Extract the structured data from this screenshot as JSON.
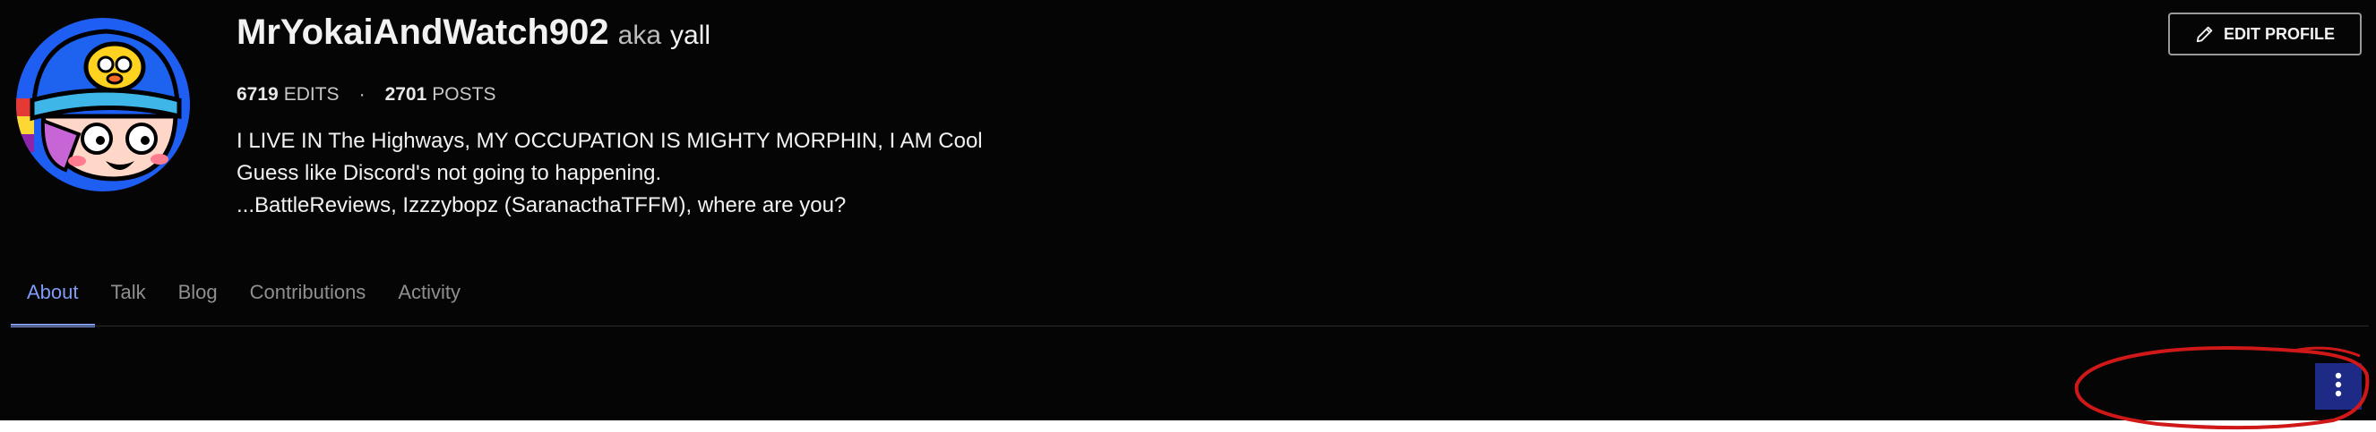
{
  "profile": {
    "username": "MrYokaiAndWatch902",
    "aka_label": "aka",
    "nickname": "yall",
    "stats": {
      "edits_count": "6719",
      "edits_label": "EDITS",
      "separator": "·",
      "posts_count": "2701",
      "posts_label": "POSTS"
    },
    "bio": [
      "I LIVE IN The Highways, MY OCCUPATION IS MIGHTY MORPHIN, I AM Cool",
      "Guess like Discord's not going to happening.",
      "...BattleReviews, Izzzybopz (SaranacthaTFFM), where are you?"
    ]
  },
  "actions": {
    "edit_profile_label": "EDIT PROFILE",
    "edit_icon": "pencil-icon",
    "more_icon": "vertical-dots-icon"
  },
  "tabs": [
    {
      "label": "About",
      "active": true
    },
    {
      "label": "Talk",
      "active": false
    },
    {
      "label": "Blog",
      "active": false
    },
    {
      "label": "Contributions",
      "active": false
    },
    {
      "label": "Activity",
      "active": false
    }
  ],
  "colors": {
    "background": "#050505",
    "accent": "#7f9cf5",
    "more_button": "#1d2a86",
    "annotation": "#d01818"
  }
}
